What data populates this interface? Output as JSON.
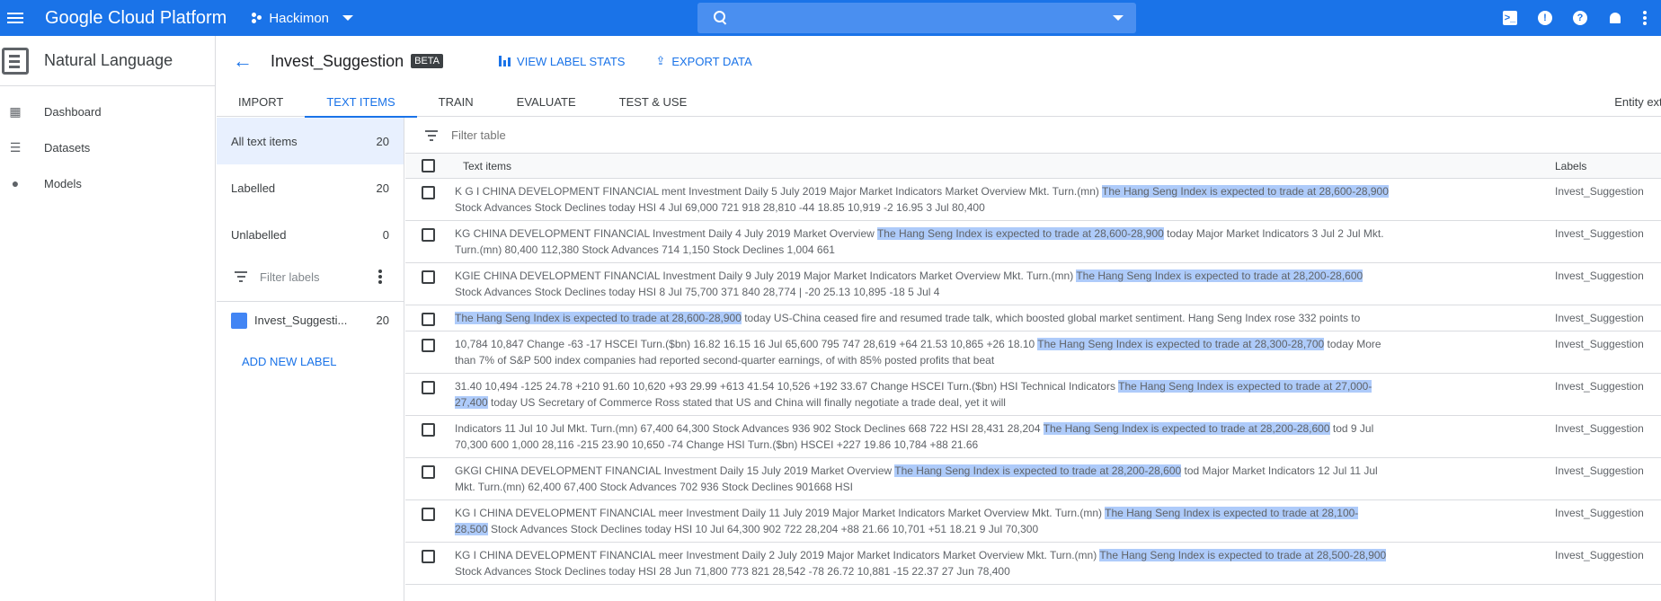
{
  "topbar": {
    "brand": "Google Cloud Platform",
    "project": "Hackimon",
    "search_placeholder": ""
  },
  "leftnav": {
    "product_name": "Natural Language",
    "items": [
      {
        "label": "Dashboard",
        "icon": "dashboard-icon"
      },
      {
        "label": "Datasets",
        "icon": "list-icon"
      },
      {
        "label": "Models",
        "icon": "lightbulb-icon"
      }
    ]
  },
  "header": {
    "dataset_name": "Invest_Suggestion",
    "badge": "BETA",
    "view_label_stats": "VIEW LABEL STATS",
    "export_data": "EXPORT DATA"
  },
  "tabs": [
    {
      "label": "IMPORT"
    },
    {
      "label": "TEXT ITEMS"
    },
    {
      "label": "TRAIN"
    },
    {
      "label": "EVALUATE"
    },
    {
      "label": "TEST & USE"
    }
  ],
  "tab_right": "Entity extr",
  "filters": {
    "all": {
      "label": "All text items",
      "count": "20"
    },
    "labelled": {
      "label": "Labelled",
      "count": "20"
    },
    "unlabelled": {
      "label": "Unlabelled",
      "count": "0"
    },
    "filter_labels_placeholder": "Filter labels",
    "label": {
      "name": "Invest_Suggesti...",
      "count": "20",
      "color": "#4285f4"
    },
    "add_new_label": "ADD NEW LABEL"
  },
  "table": {
    "filter_placeholder": "Filter table",
    "headers": {
      "text": "Text items",
      "labels": "Labels"
    },
    "rows": [
      {
        "pre": "K G I CHINA DEVELOPMENT FINANCIAL ment Investment Daily 5 July 2019 Major Market Indicators Market Overview Mkt. Turn.(mn) ",
        "hl": "The Hang Seng Index is expected to trade at 28,600-28,900",
        "post": " Stock Advances Stock Declines today HSI 4 Jul 69,000 721 918 28,810 -44 18.85 10,919 -2 16.95 3 Jul 80,400",
        "label": "Invest_Suggestion"
      },
      {
        "pre": "KG CHINA DEVELOPMENT FINANCIAL Investment Daily 4 July 2019 Market Overview ",
        "hl": "The Hang Seng Index is expected to trade at 28,600-28,900",
        "post": " today Major Market Indicators 3 Jul 2 Jul Mkt. Turn.(mn) 80,400 112,380 Stock Advances 714 1,150 Stock Declines 1,004 661",
        "label": "Invest_Suggestion"
      },
      {
        "pre": "KGIE CHINA DEVELOPMENT FINANCIAL Investment Daily 9 July 2019 Major Market Indicators Market Overview Mkt. Turn.(mn) ",
        "hl": "The Hang Seng Index is expected to trade at 28,200-28,600",
        "post": " Stock Advances Stock Declines today HSI 8 Jul 75,700 371 840 28,774 | -20 25.13 10,895 -18 5 Jul 4",
        "label": "Invest_Suggestion"
      },
      {
        "pre": "",
        "hl": "The Hang Seng Index is expected to trade at 28,600-28,900",
        "post": " today US-China ceased fire and resumed trade talk, which boosted global market sentiment. Hang Seng Index rose 332 points to",
        "label": "Invest_Suggestion"
      },
      {
        "pre": "10,784 10,847 Change -63 -17 HSCEI Turn.($bn) 16.82 16.15 16 Jul 65,600 795 747 28,619 +64 21.53 10,865 +26 18.10 ",
        "hl": "The Hang Seng Index is expected to trade at 28,300-28,700",
        "post": " today More than 7% of S&P 500 index companies had reported second-quarter earnings, of with 85% posted profits that beat",
        "label": "Invest_Suggestion"
      },
      {
        "pre": "31.40 10,494 -125 24.78 +210 91.60 10,620 +93 29.99 +613 41.54 10,526 +192 33.67 Change HSCEI Turn.($bn) HSI Technical Indicators ",
        "hl": "The Hang Seng Index is expected to trade at 27,000-27,400",
        "post": " today US Secretary of Commerce Ross stated that US and China will finally negotiate a trade deal, yet it will",
        "label": "Invest_Suggestion"
      },
      {
        "pre": "Indicators 11 Jul 10 Jul Mkt. Turn.(mn) 67,400 64,300 Stock Advances 936 902 Stock Declines 668 722 HSI 28,431 28,204 ",
        "hl": "The Hang Seng Index is expected to trade at 28,200-28,600",
        "post": " tod 9 Jul 70,300 600 1,000 28,116 -215 23.90 10,650 -74 Change HSI Turn.($bn) HSCEI +227 19.86 10,784 +88 21.66",
        "label": "Invest_Suggestion"
      },
      {
        "pre": "GKGI CHINA DEVELOPMENT FINANCIAL Investment Daily 15 July 2019 Market Overview ",
        "hl": "The Hang Seng Index is expected to trade at 28,200-28,600",
        "post": " tod Major Market Indicators 12 Jul 11 Jul Mkt. Turn.(mn) 62,400 67,400 Stock Advances 702 936 Stock Declines 901668 HSI",
        "label": "Invest_Suggestion"
      },
      {
        "pre": "KG I CHINA DEVELOPMENT FINANCIAL meer Investment Daily 11 July 2019 Major Market Indicators Market Overview Mkt. Turn.(mn) ",
        "hl": "The Hang Seng Index is expected to trade at 28,100-28,500",
        "post": " Stock Advances Stock Declines today HSI 10 Jul 64,300 902 722 28,204 +88 21.66 10,701 +51 18.21 9 Jul 70,300",
        "label": "Invest_Suggestion"
      },
      {
        "pre": "KG I CHINA DEVELOPMENT FINANCIAL meer Investment Daily 2 July 2019 Major Market Indicators Market Overview Mkt. Turn.(mn) ",
        "hl": "The Hang Seng Index is expected to trade at 28,500-28,900",
        "post": " Stock Advances Stock Declines today HSI 28 Jun 71,800 773 821 28,542 -78 26.72 10,881 -15 22.37 27 Jun 78,400",
        "label": "Invest_Suggestion"
      }
    ]
  }
}
